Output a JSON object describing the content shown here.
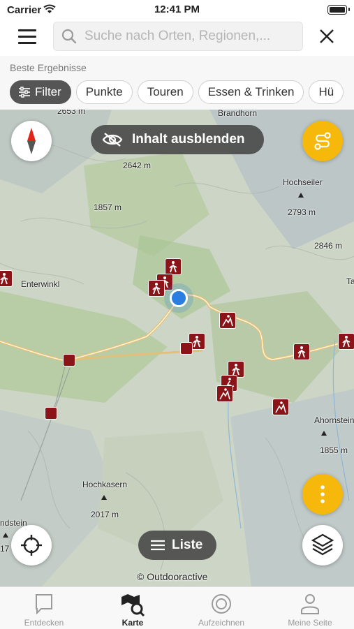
{
  "status_bar": {
    "carrier": "Carrier",
    "time": "12:41 PM"
  },
  "search": {
    "placeholder": "Suche nach Orten, Regionen,..."
  },
  "results": {
    "label": "Beste Ergebnisse",
    "chips": [
      "Filter",
      "Punkte",
      "Touren",
      "Essen & Trinken",
      "Hü"
    ]
  },
  "map": {
    "hide_content_label": "Inhalt ausblenden",
    "list_label": "Liste",
    "copyright": "© Outdooractive",
    "labels": {
      "e2653": "2653 m",
      "brandhorn": "Brandhorn",
      "e2642": "2642 m",
      "hochseiler": "Hochseiler",
      "e2793": "2793 m",
      "e1857": "1857 m",
      "e2846": "2846 m",
      "enterwinkl": "Enterwinkl",
      "ta": "Ta",
      "ahornstein": "Ahornstein",
      "e1855": "1855 m",
      "hochkasern": "Hochkasern",
      "e2017": "2017 m",
      "ndstein": "ndstein",
      "e17": "17"
    }
  },
  "tabs": [
    {
      "label": "Entdecken",
      "icon": "bookmark-icon"
    },
    {
      "label": "Karte",
      "icon": "map-search-icon",
      "active": true
    },
    {
      "label": "Aufzeichnen",
      "icon": "record-icon"
    },
    {
      "label": "Meine Seite",
      "icon": "person-icon"
    }
  ],
  "colors": {
    "accent": "#f6b80a",
    "poi": "#8b1418",
    "location": "#2a7de1"
  }
}
